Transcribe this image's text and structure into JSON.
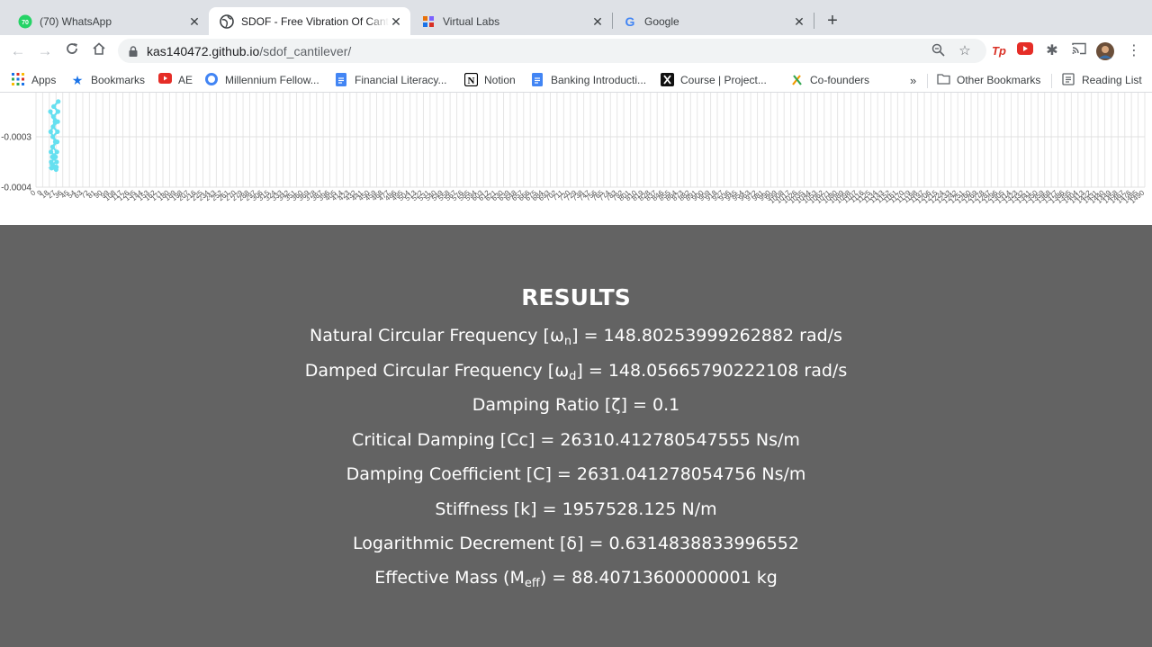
{
  "browser": {
    "tabs": [
      {
        "title": "(70) WhatsApp",
        "favicon": "whatsapp-icon",
        "badge": "70",
        "active": false
      },
      {
        "title": "SDOF - Free Vibration Of Cantilever",
        "favicon": "globe-icon",
        "active": true
      },
      {
        "title": "Virtual Labs",
        "favicon": "virtual-labs-icon",
        "active": false
      },
      {
        "title": "Google",
        "favicon": "google-icon",
        "active": false
      }
    ],
    "new_tab_symbol": "+",
    "url_host": "kas140472.github.io",
    "url_path": "/sdof_cantilever/"
  },
  "bookmarks": {
    "items": [
      {
        "label": "Apps",
        "icon": "apps-grid-icon"
      },
      {
        "label": "Bookmarks",
        "icon": "star-icon"
      },
      {
        "label": "AE",
        "icon": "youtube-icon"
      },
      {
        "label": "Millennium Fellow...",
        "icon": "chrome-ring-icon"
      },
      {
        "label": "Financial Literacy...",
        "icon": "docs-icon"
      },
      {
        "label": "Notion",
        "icon": "notion-icon"
      },
      {
        "label": "Banking Introducti...",
        "icon": "docs-icon"
      },
      {
        "label": "Course | Project...",
        "icon": "x-logo-icon"
      },
      {
        "label": "Co-founders",
        "icon": "cofounders-icon"
      }
    ],
    "overflow": "»",
    "other_bookmarks": "Other Bookmarks",
    "reading_list": "Reading List"
  },
  "chart_data": {
    "type": "line",
    "title": "",
    "xlabel": "",
    "ylabel": "",
    "y_tick_labels": [
      "-0.0003",
      "-0.0004"
    ],
    "y_ticks": [
      -0.0003,
      -0.0004
    ],
    "x_tick_labels": [
      "0",
      "9",
      "18",
      "27",
      "36",
      "45",
      "54",
      "63",
      "72",
      "81",
      "90",
      "99",
      "108",
      "117",
      "126",
      "135",
      "144",
      "153",
      "162",
      "171",
      "180",
      "189",
      "198",
      "207",
      "216",
      "225",
      "234",
      "243",
      "252",
      "261",
      "270",
      "279",
      "288",
      "297",
      "306",
      "315",
      "324",
      "333",
      "342",
      "351",
      "360",
      "369",
      "378",
      "387",
      "396",
      "405",
      "414",
      "423",
      "432",
      "441",
      "450",
      "459",
      "468",
      "477",
      "486",
      "495",
      "504",
      "513",
      "522",
      "531",
      "540",
      "549",
      "558",
      "567",
      "576",
      "585",
      "594",
      "603",
      "612",
      "621",
      "630",
      "639",
      "648",
      "657",
      "666",
      "675",
      "684",
      "693",
      "702",
      "711",
      "720",
      "729",
      "738",
      "747",
      "756",
      "765",
      "774",
      "783",
      "792",
      "801",
      "810",
      "819",
      "828",
      "837",
      "846",
      "855",
      "864",
      "873",
      "882",
      "891",
      "900",
      "909",
      "918",
      "927",
      "936",
      "945",
      "954",
      "963",
      "972",
      "981",
      "990",
      "999",
      "1008",
      "1017",
      "1026",
      "1035",
      "1044",
      "1053",
      "1062",
      "1071",
      "1080",
      "1089",
      "1098",
      "1107",
      "1116",
      "1125",
      "1134",
      "1143",
      "1152",
      "1161",
      "1170",
      "1179",
      "1188",
      "1197",
      "1206",
      "1215",
      "1224",
      "1233",
      "1242",
      "1251",
      "1260",
      "1269",
      "1278",
      "1287",
      "1296",
      "1305",
      "1314",
      "1323",
      "1332",
      "1341",
      "1350",
      "1359",
      "1368",
      "1377",
      "1386",
      "1395",
      "1404",
      "1413",
      "1422",
      "1431",
      "1440",
      "1449",
      "1458",
      "1467",
      "1476",
      "1485",
      "1490"
    ],
    "series": [
      {
        "color": "#66e0f0",
        "x": [
          0,
          1,
          2,
          3,
          4,
          5,
          6,
          7,
          8,
          9,
          10,
          11,
          12,
          13,
          14,
          15,
          16,
          17,
          18,
          19,
          20,
          21,
          22,
          23,
          24,
          25
        ],
        "y": [
          -0.00025,
          -0.00027,
          -0.00029,
          -0.00031,
          -0.00033,
          -0.00034,
          -0.00035,
          -0.00036,
          -0.000362,
          -0.000365,
          -0.000362,
          -0.00036,
          -0.000355,
          -0.00035,
          -0.00034,
          -0.00033,
          -0.00032,
          -0.00031,
          -0.0003,
          -0.00029,
          -0.00028,
          -0.00027,
          -0.00026,
          -0.00025,
          -0.00024,
          -0.00023
        ]
      }
    ],
    "grid": true
  },
  "results": {
    "heading": "RESULTS",
    "lines": [
      {
        "pre": "Natural Circular Frequency [ω",
        "sub": "n",
        "post": "] = 148.80253999262882 rad/s"
      },
      {
        "pre": "Damped Circular Frequency [ω",
        "sub": "d",
        "post": "] = 148.05665790222108 rad/s"
      },
      {
        "pre": "Damping Ratio [ζ] = 0.1",
        "sub": "",
        "post": ""
      },
      {
        "pre": "Critical Damping [Cc] = 26310.412780547555 Ns/m",
        "sub": "",
        "post": ""
      },
      {
        "pre": "Damping Coefficient [C] = 2631.041278054756 Ns/m",
        "sub": "",
        "post": ""
      },
      {
        "pre": "Stiffness [k] = 1957528.125 N/m",
        "sub": "",
        "post": ""
      },
      {
        "pre": "Logarithmic Decrement [δ] = 0.6314838833996552",
        "sub": "",
        "post": ""
      },
      {
        "pre": "Effective Mass (M",
        "sub": "eff",
        "post": ") = 88.40713600000001 kg"
      }
    ]
  }
}
